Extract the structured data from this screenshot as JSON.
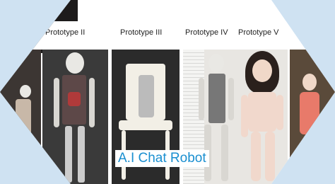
{
  "labels": {
    "p2": "Prototype II",
    "p3": "Prototype III",
    "p4": "Prototype IV",
    "p5": "Prototype V"
  },
  "caption": "A.I Chat Robot",
  "colors": {
    "caption_text": "#1a8fd0",
    "frame_bg": "#cfe2f2"
  }
}
